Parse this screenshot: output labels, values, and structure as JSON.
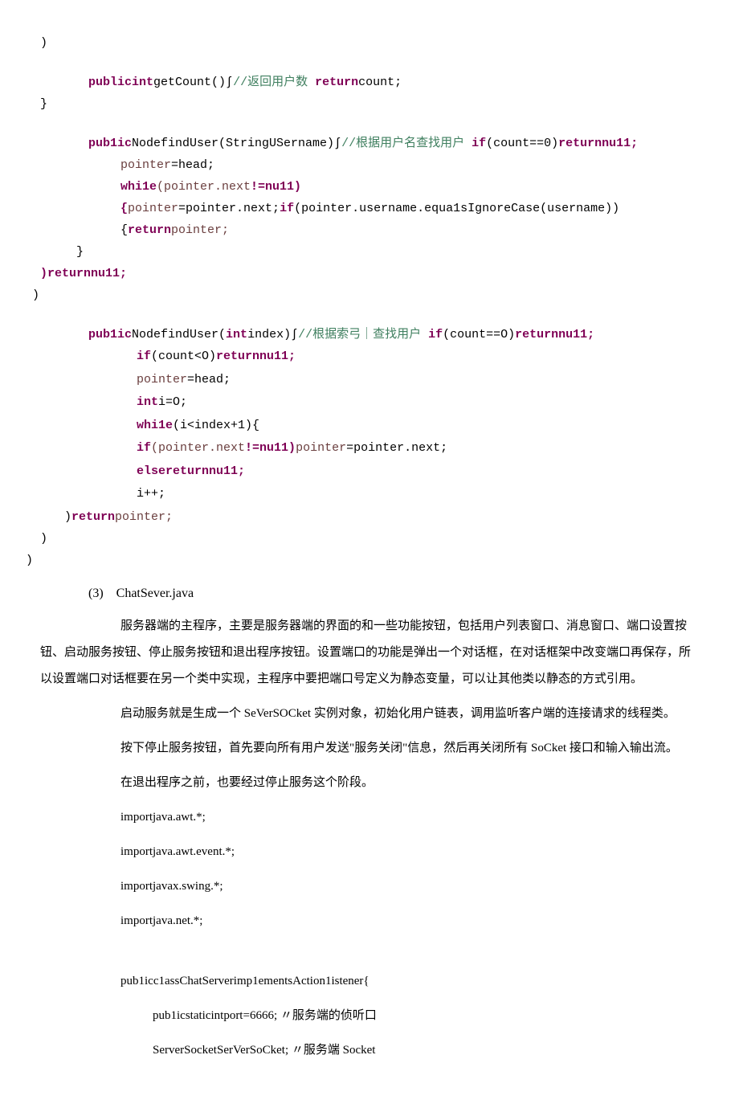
{
  "code": {
    "l01": ")",
    "l02a": "public",
    "l02b": "int",
    "l02c": "getCount()∫",
    "l02d": "//返回用户数 ",
    "l02e": "return",
    "l02f": "count;",
    "l03": "}",
    "l04a": "pub1ic",
    "l04b": "NodefindUser(StringUSername)∫",
    "l04c": "//根据用户名查找用户 ",
    "l04d": "if",
    "l04e": "(count==0)",
    "l04f": "returnnu11;",
    "l05a": "pointer",
    "l05b": "=head;",
    "l06a": "whi1e",
    "l06b": "(pointer.next",
    "l06c": "!=nu11){",
    "l06d": "pointer",
    "l06e": "=pointer.next;",
    "l06f": "if",
    "l06g": "(pointer.username.equa1sIgnoreCase(username)){",
    "l06h": "return",
    "l06i": "pointer;",
    "l07": "}",
    "l08a": ")",
    "l08b": "returnnu11;",
    "l09": ")",
    "l10a": "pub1ic",
    "l10b": "NodefindUser(",
    "l10c": "int",
    "l10d": "index)∫",
    "l10e": "//根据索弓｜查找用户 ",
    "l10f": "if",
    "l10g": "(count==O)",
    "l10h": "returnnu11;",
    "l11a": "if",
    "l11b": "(count<O)",
    "l11c": "returnnu11;",
    "l12a": "pointer",
    "l12b": "=head;",
    "l13a": "int",
    "l13b": "i=O;",
    "l14a": "whi1e",
    "l14b": "(i<index+1){",
    "l15a": "if",
    "l15b": "(pointer.next",
    "l15c": "!=nu11)",
    "l15d": "pointer",
    "l15e": "=pointer.next;",
    "l16a": "else",
    "l16b": "returnnu11;",
    "l17": "i++;",
    "l18a": ")",
    "l18b": "return",
    "l18c": "pointer;",
    "l19": ")",
    "l20": ")"
  },
  "section_label": "(3)　ChatSever.java",
  "prose": {
    "p1": "服务器端的主程序，主要是服务器端的界面的和一些功能按钮，包括用户列表窗口、消息窗口、端口设置按钮、启动服务按钮、停止服务按钮和退出程序按钮。设置端口的功能是弹出一个对话框，在对话框架中改变端口再保存，所以设置端口对话框要在另一个类中实现，主程序中要把端口号定义为静态变量，可以让其他类以静态的方式引用。",
    "p2": "启动服务就是生成一个 SeVerSOCket 实例对象，初始化用户链表，调用监听客户端的连接请求的线程类。",
    "p3": "按下停止服务按钮，首先要向所有用户发送\"服务关闭\"信息，然后再关闭所有 SoCket 接口和输入输出流。",
    "p4": "在退出程序之前，也要经过停止服务这个阶段。",
    "imp1": "importjava.awt.*;",
    "imp2": "importjava.awt.event.*;",
    "imp3": "importjavax.swing.*;",
    "imp4": "importjava.net.*;",
    "cls1": "pub1icc1assChatServerimp1ementsAction1istener{",
    "cls2": "pub1icstaticintport=6666; 〃服务端的侦听口",
    "cls3": "ServerSocketSerVerSoCket; 〃服务端 Socket"
  }
}
